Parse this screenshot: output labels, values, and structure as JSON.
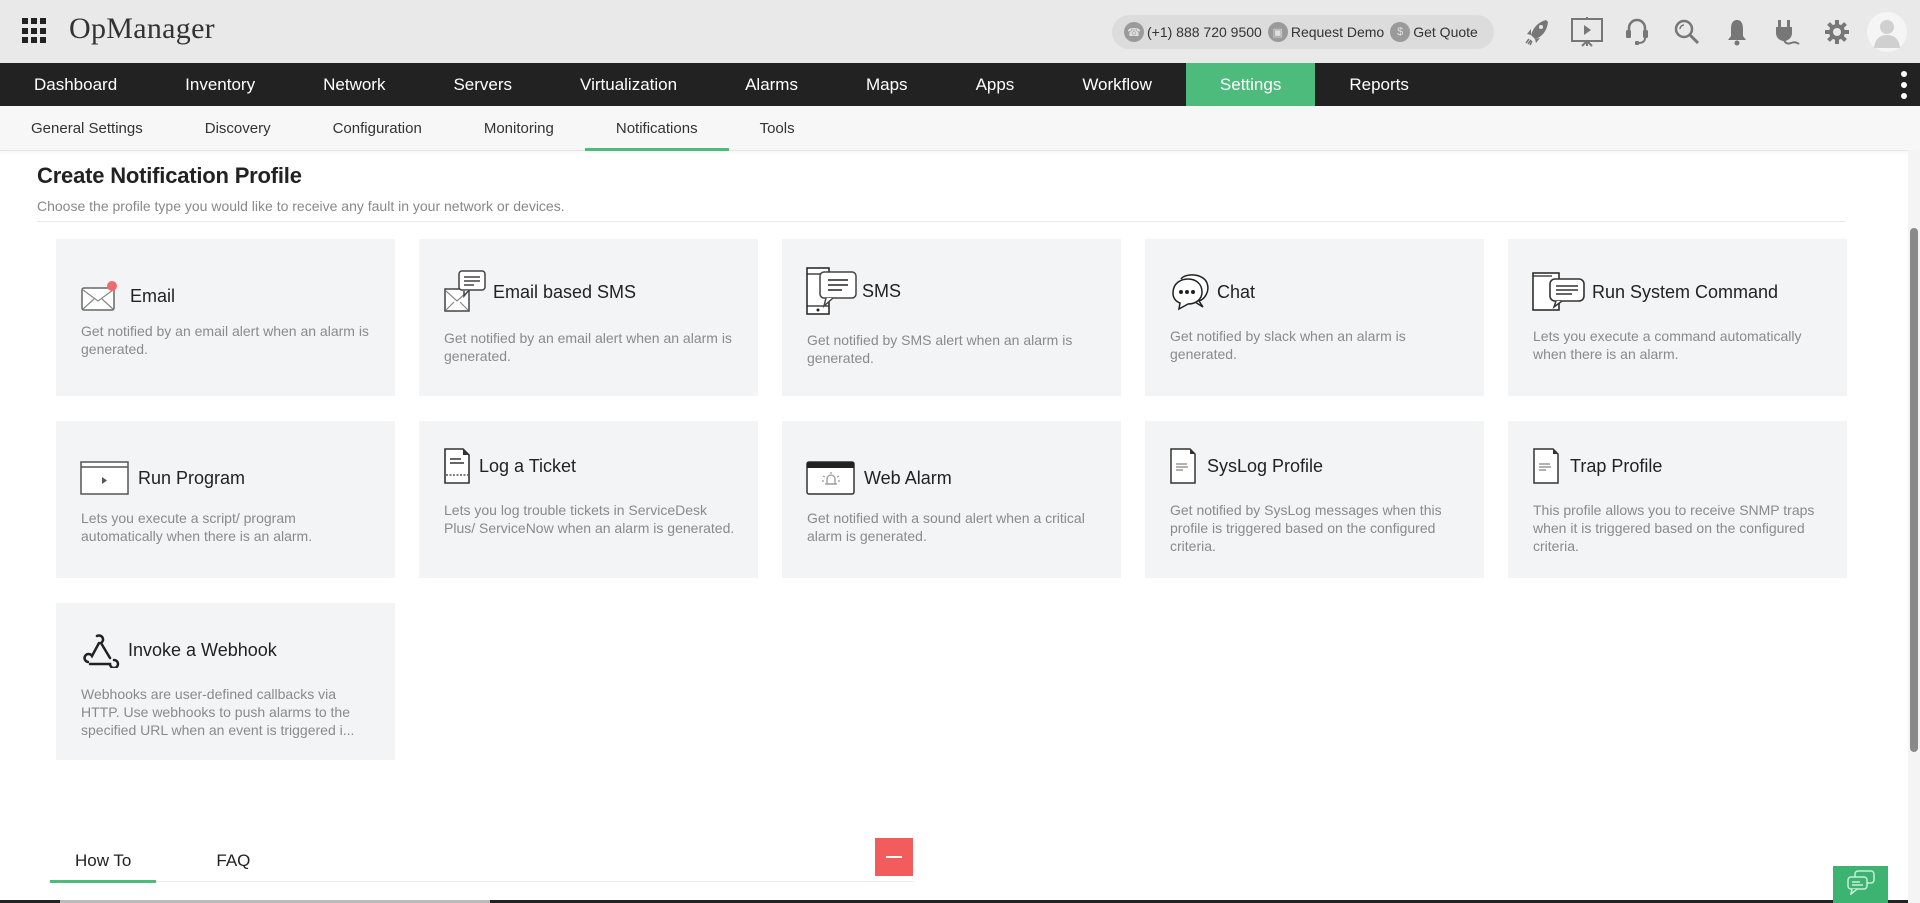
{
  "header": {
    "app_title": "OpManager",
    "contact": {
      "phone": "(+1) 888 720 9500",
      "request_demo": "Request Demo",
      "get_quote": "Get Quote"
    },
    "icons": [
      "rocket-icon",
      "presentation-icon",
      "headset-icon",
      "search-icon",
      "bell-icon",
      "plug-icon",
      "gear-icon",
      "user-avatar"
    ]
  },
  "main_nav": {
    "items": [
      {
        "label": "Dashboard"
      },
      {
        "label": "Inventory"
      },
      {
        "label": "Network"
      },
      {
        "label": "Servers"
      },
      {
        "label": "Virtualization"
      },
      {
        "label": "Alarms"
      },
      {
        "label": "Maps"
      },
      {
        "label": "Apps"
      },
      {
        "label": "Workflow"
      },
      {
        "label": "Settings"
      },
      {
        "label": "Reports"
      }
    ],
    "active": "Settings"
  },
  "sub_nav": {
    "items": [
      {
        "label": "General Settings"
      },
      {
        "label": "Discovery"
      },
      {
        "label": "Configuration"
      },
      {
        "label": "Monitoring"
      },
      {
        "label": "Notifications"
      },
      {
        "label": "Tools"
      }
    ],
    "active": "Notifications"
  },
  "page": {
    "title": "Create Notification Profile",
    "subtitle": "Choose the profile type you would like to receive any fault in your network or devices."
  },
  "profiles": [
    {
      "title": "Email",
      "icon": "email-icon",
      "description": "Get notified by an email alert when an alarm is generated."
    },
    {
      "title": "Email based SMS",
      "icon": "email-sms-icon",
      "description": "Get notified by an email alert when an alarm is generated."
    },
    {
      "title": "SMS",
      "icon": "sms-phone-icon",
      "description": "Get notified by SMS alert when an alarm is generated."
    },
    {
      "title": "Chat",
      "icon": "chat-icon",
      "description": "Get notified by slack when an alarm is generated."
    },
    {
      "title": "Run System Command",
      "icon": "system-command-icon",
      "description": "Lets you execute a command automatically when there is an alarm."
    },
    {
      "title": "Run Program",
      "icon": "run-program-icon",
      "description": "Lets you execute a script/ program automatically when there is an alarm."
    },
    {
      "title": "Log a Ticket",
      "icon": "ticket-icon",
      "description": "Lets you log trouble tickets in ServiceDesk Plus/ ServiceNow when an alarm is generated."
    },
    {
      "title": "Web Alarm",
      "icon": "web-alarm-icon",
      "description": "Get notified with a sound alert when a critical alarm is generated."
    },
    {
      "title": "SysLog Profile",
      "icon": "syslog-document-icon",
      "description": "Get notified by SysLog messages when this profile is triggered based on the configured criteria."
    },
    {
      "title": "Trap Profile",
      "icon": "trap-document-icon",
      "description": "This profile allows you to receive SNMP traps when it is triggered based on the configured criteria."
    },
    {
      "title": "Invoke a Webhook",
      "icon": "webhook-icon",
      "description": "Webhooks are user-defined callbacks via HTTP. Use webhooks to push alarms to the specified URL when an event is triggered i..."
    }
  ],
  "bottom_tabs": {
    "items": [
      {
        "label": "How To"
      },
      {
        "label": "FAQ"
      }
    ],
    "active": "How To"
  },
  "colors": {
    "accent": "#4dbb7c",
    "nav_bg": "#222222",
    "collapse_button": "#f25c5c",
    "email_badge": "#f06b6b"
  }
}
